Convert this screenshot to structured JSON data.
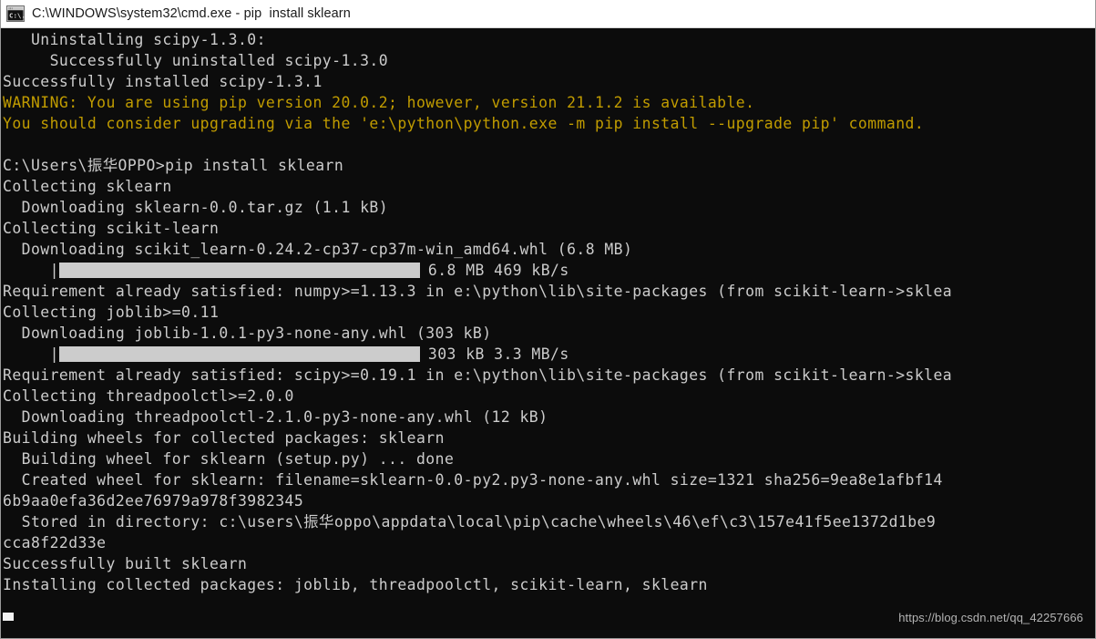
{
  "window": {
    "title": "C:\\WINDOWS\\system32\\cmd.exe - pip  install sklearn",
    "icon": "cmd-console-icon",
    "background_color": "#0c0c0c",
    "foreground_color": "#cccccc",
    "warning_color": "#c19c00",
    "titlebar_background": "#ffffff",
    "titlebar_color": "#1a1a1a"
  },
  "console": {
    "lines": [
      {
        "text": "   Uninstalling scipy-1.3.0:",
        "style": "normal"
      },
      {
        "text": "     Successfully uninstalled scipy-1.3.0",
        "style": "normal"
      },
      {
        "text": "Successfully installed scipy-1.3.1",
        "style": "normal"
      },
      {
        "text": "WARNING: You are using pip version 20.0.2; however, version 21.1.2 is available.",
        "style": "warning"
      },
      {
        "text": "You should consider upgrading via the 'e:\\python\\python.exe -m pip install --upgrade pip' command.",
        "style": "warning"
      },
      {
        "text": "",
        "style": "blank"
      },
      {
        "text": "C:\\Users\\振华OPPO>pip install sklearn",
        "style": "normal"
      },
      {
        "text": "Collecting sklearn",
        "style": "normal"
      },
      {
        "text": "  Downloading sklearn-0.0.tar.gz (1.1 kB)",
        "style": "normal"
      },
      {
        "text": "Collecting scikit-learn",
        "style": "normal"
      },
      {
        "text": "  Downloading scikit_learn-0.24.2-cp37-cp37m-win_amd64.whl (6.8 MB)",
        "style": "normal"
      },
      {
        "style": "progress",
        "indent": "     ",
        "pipe": "|",
        "fill_width": 396,
        "text": "6.8 MB 469 kB/s"
      },
      {
        "text": "Requirement already satisfied: numpy>=1.13.3 in e:\\python\\lib\\site-packages (from scikit-learn->sklea",
        "style": "normal"
      },
      {
        "text": "Collecting joblib>=0.11",
        "style": "normal"
      },
      {
        "text": "  Downloading joblib-1.0.1-py3-none-any.whl (303 kB)",
        "style": "normal"
      },
      {
        "style": "progress",
        "indent": "     ",
        "pipe": "|",
        "fill_width": 396,
        "text": "303 kB 3.3 MB/s"
      },
      {
        "text": "Requirement already satisfied: scipy>=0.19.1 in e:\\python\\lib\\site-packages (from scikit-learn->sklea",
        "style": "normal"
      },
      {
        "text": "Collecting threadpoolctl>=2.0.0",
        "style": "normal"
      },
      {
        "text": "  Downloading threadpoolctl-2.1.0-py3-none-any.whl (12 kB)",
        "style": "normal"
      },
      {
        "text": "Building wheels for collected packages: sklearn",
        "style": "normal"
      },
      {
        "text": "  Building wheel for sklearn (setup.py) ... done",
        "style": "normal"
      },
      {
        "text": "  Created wheel for sklearn: filename=sklearn-0.0-py2.py3-none-any.whl size=1321 sha256=9ea8e1afbf14",
        "style": "normal"
      },
      {
        "text": "6b9aa0efa36d2ee76979a978f3982345",
        "style": "normal"
      },
      {
        "text": "  Stored in directory: c:\\users\\振华oppo\\appdata\\local\\pip\\cache\\wheels\\46\\ef\\c3\\157e41f5ee1372d1be9",
        "style": "normal"
      },
      {
        "text": "cca8f22d33e",
        "style": "normal"
      },
      {
        "text": "Successfully built sklearn",
        "style": "normal"
      },
      {
        "text": "Installing collected packages: joblib, threadpoolctl, scikit-learn, sklearn",
        "style": "normal"
      }
    ],
    "cursor_visible": true,
    "watermark": "https://blog.csdn.net/qq_42257666"
  }
}
